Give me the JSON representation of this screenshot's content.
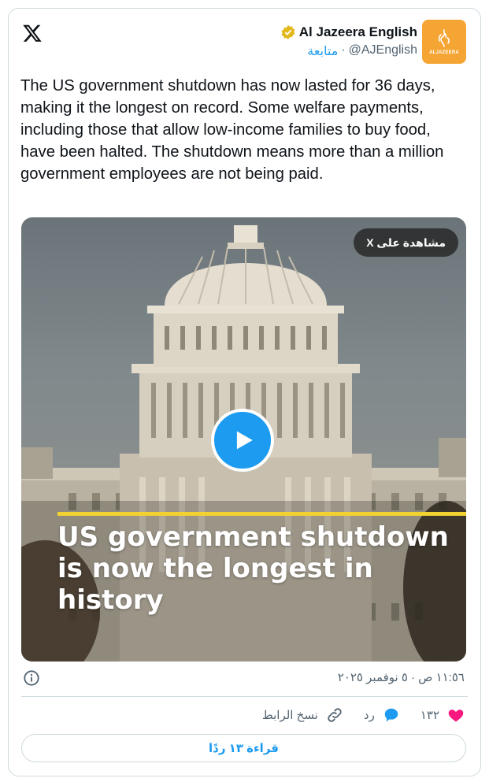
{
  "author": {
    "name": "Al Jazeera English",
    "handle": "@AJEnglish",
    "follow_label": "متابعة",
    "separator": "·",
    "avatar_text": "ALJAZEERA"
  },
  "tweet": {
    "text": "The US government shutdown has now lasted for 36 days, making it the longest on record. Some welfare payments, including those that allow low-income families to buy food, have been halted. The shutdown means more than a million government employees are not being paid."
  },
  "media": {
    "watch_label": "مشاهدة على X",
    "caption": "US government shutdown is now the longest in history"
  },
  "meta": {
    "timestamp": "١١:٥٦ ص · ٥ نوفمبر ٢٠٢٥"
  },
  "actions": {
    "likes_count": "١٣٢",
    "reply_label": "رد",
    "copy_link_label": "نسخ الرابط"
  },
  "read_replies_label": "قراءة ١٣ ردًا",
  "colors": {
    "accent": "#1d9bf0",
    "like": "#f91880",
    "caption_bar": "#f2d230",
    "avatar_bg": "#f5a533"
  }
}
